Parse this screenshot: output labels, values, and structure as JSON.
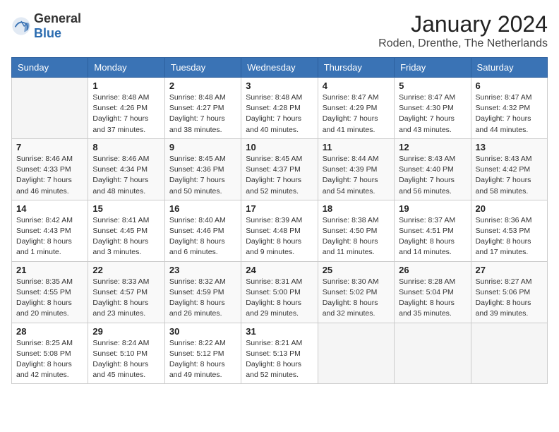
{
  "header": {
    "logo": {
      "general": "General",
      "blue": "Blue"
    },
    "title": "January 2024",
    "location": "Roden, Drenthe, The Netherlands"
  },
  "weekdays": [
    "Sunday",
    "Monday",
    "Tuesday",
    "Wednesday",
    "Thursday",
    "Friday",
    "Saturday"
  ],
  "weeks": [
    [
      {
        "day": "",
        "sunrise": "",
        "sunset": "",
        "daylight": ""
      },
      {
        "day": "1",
        "sunrise": "Sunrise: 8:48 AM",
        "sunset": "Sunset: 4:26 PM",
        "daylight": "Daylight: 7 hours and 37 minutes."
      },
      {
        "day": "2",
        "sunrise": "Sunrise: 8:48 AM",
        "sunset": "Sunset: 4:27 PM",
        "daylight": "Daylight: 7 hours and 38 minutes."
      },
      {
        "day": "3",
        "sunrise": "Sunrise: 8:48 AM",
        "sunset": "Sunset: 4:28 PM",
        "daylight": "Daylight: 7 hours and 40 minutes."
      },
      {
        "day": "4",
        "sunrise": "Sunrise: 8:47 AM",
        "sunset": "Sunset: 4:29 PM",
        "daylight": "Daylight: 7 hours and 41 minutes."
      },
      {
        "day": "5",
        "sunrise": "Sunrise: 8:47 AM",
        "sunset": "Sunset: 4:30 PM",
        "daylight": "Daylight: 7 hours and 43 minutes."
      },
      {
        "day": "6",
        "sunrise": "Sunrise: 8:47 AM",
        "sunset": "Sunset: 4:32 PM",
        "daylight": "Daylight: 7 hours and 44 minutes."
      }
    ],
    [
      {
        "day": "7",
        "sunrise": "Sunrise: 8:46 AM",
        "sunset": "Sunset: 4:33 PM",
        "daylight": "Daylight: 7 hours and 46 minutes."
      },
      {
        "day": "8",
        "sunrise": "Sunrise: 8:46 AM",
        "sunset": "Sunset: 4:34 PM",
        "daylight": "Daylight: 7 hours and 48 minutes."
      },
      {
        "day": "9",
        "sunrise": "Sunrise: 8:45 AM",
        "sunset": "Sunset: 4:36 PM",
        "daylight": "Daylight: 7 hours and 50 minutes."
      },
      {
        "day": "10",
        "sunrise": "Sunrise: 8:45 AM",
        "sunset": "Sunset: 4:37 PM",
        "daylight": "Daylight: 7 hours and 52 minutes."
      },
      {
        "day": "11",
        "sunrise": "Sunrise: 8:44 AM",
        "sunset": "Sunset: 4:39 PM",
        "daylight": "Daylight: 7 hours and 54 minutes."
      },
      {
        "day": "12",
        "sunrise": "Sunrise: 8:43 AM",
        "sunset": "Sunset: 4:40 PM",
        "daylight": "Daylight: 7 hours and 56 minutes."
      },
      {
        "day": "13",
        "sunrise": "Sunrise: 8:43 AM",
        "sunset": "Sunset: 4:42 PM",
        "daylight": "Daylight: 7 hours and 58 minutes."
      }
    ],
    [
      {
        "day": "14",
        "sunrise": "Sunrise: 8:42 AM",
        "sunset": "Sunset: 4:43 PM",
        "daylight": "Daylight: 8 hours and 1 minute."
      },
      {
        "day": "15",
        "sunrise": "Sunrise: 8:41 AM",
        "sunset": "Sunset: 4:45 PM",
        "daylight": "Daylight: 8 hours and 3 minutes."
      },
      {
        "day": "16",
        "sunrise": "Sunrise: 8:40 AM",
        "sunset": "Sunset: 4:46 PM",
        "daylight": "Daylight: 8 hours and 6 minutes."
      },
      {
        "day": "17",
        "sunrise": "Sunrise: 8:39 AM",
        "sunset": "Sunset: 4:48 PM",
        "daylight": "Daylight: 8 hours and 9 minutes."
      },
      {
        "day": "18",
        "sunrise": "Sunrise: 8:38 AM",
        "sunset": "Sunset: 4:50 PM",
        "daylight": "Daylight: 8 hours and 11 minutes."
      },
      {
        "day": "19",
        "sunrise": "Sunrise: 8:37 AM",
        "sunset": "Sunset: 4:51 PM",
        "daylight": "Daylight: 8 hours and 14 minutes."
      },
      {
        "day": "20",
        "sunrise": "Sunrise: 8:36 AM",
        "sunset": "Sunset: 4:53 PM",
        "daylight": "Daylight: 8 hours and 17 minutes."
      }
    ],
    [
      {
        "day": "21",
        "sunrise": "Sunrise: 8:35 AM",
        "sunset": "Sunset: 4:55 PM",
        "daylight": "Daylight: 8 hours and 20 minutes."
      },
      {
        "day": "22",
        "sunrise": "Sunrise: 8:33 AM",
        "sunset": "Sunset: 4:57 PM",
        "daylight": "Daylight: 8 hours and 23 minutes."
      },
      {
        "day": "23",
        "sunrise": "Sunrise: 8:32 AM",
        "sunset": "Sunset: 4:59 PM",
        "daylight": "Daylight: 8 hours and 26 minutes."
      },
      {
        "day": "24",
        "sunrise": "Sunrise: 8:31 AM",
        "sunset": "Sunset: 5:00 PM",
        "daylight": "Daylight: 8 hours and 29 minutes."
      },
      {
        "day": "25",
        "sunrise": "Sunrise: 8:30 AM",
        "sunset": "Sunset: 5:02 PM",
        "daylight": "Daylight: 8 hours and 32 minutes."
      },
      {
        "day": "26",
        "sunrise": "Sunrise: 8:28 AM",
        "sunset": "Sunset: 5:04 PM",
        "daylight": "Daylight: 8 hours and 35 minutes."
      },
      {
        "day": "27",
        "sunrise": "Sunrise: 8:27 AM",
        "sunset": "Sunset: 5:06 PM",
        "daylight": "Daylight: 8 hours and 39 minutes."
      }
    ],
    [
      {
        "day": "28",
        "sunrise": "Sunrise: 8:25 AM",
        "sunset": "Sunset: 5:08 PM",
        "daylight": "Daylight: 8 hours and 42 minutes."
      },
      {
        "day": "29",
        "sunrise": "Sunrise: 8:24 AM",
        "sunset": "Sunset: 5:10 PM",
        "daylight": "Daylight: 8 hours and 45 minutes."
      },
      {
        "day": "30",
        "sunrise": "Sunrise: 8:22 AM",
        "sunset": "Sunset: 5:12 PM",
        "daylight": "Daylight: 8 hours and 49 minutes."
      },
      {
        "day": "31",
        "sunrise": "Sunrise: 8:21 AM",
        "sunset": "Sunset: 5:13 PM",
        "daylight": "Daylight: 8 hours and 52 minutes."
      },
      {
        "day": "",
        "sunrise": "",
        "sunset": "",
        "daylight": ""
      },
      {
        "day": "",
        "sunrise": "",
        "sunset": "",
        "daylight": ""
      },
      {
        "day": "",
        "sunrise": "",
        "sunset": "",
        "daylight": ""
      }
    ]
  ]
}
